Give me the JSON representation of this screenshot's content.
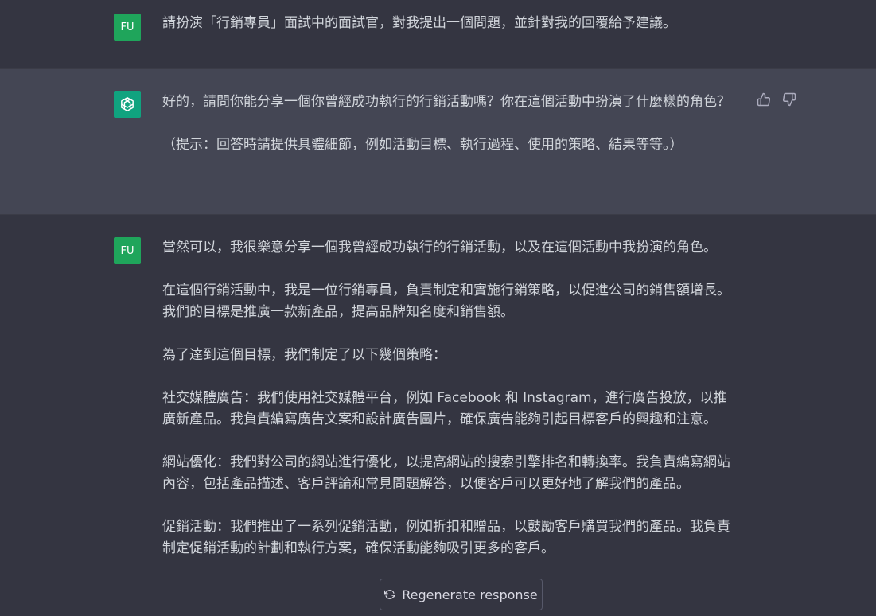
{
  "messages": [
    {
      "role": "user",
      "avatar": "FU",
      "paragraphs": [
        "請扮演「行銷專員」面試中的面試官，對我提出一個問題，並針對我的回覆給予建議。"
      ]
    },
    {
      "role": "assistant",
      "avatar_icon": "openai-logo-icon",
      "paragraphs": [
        "好的，請問你能分享一個你曾經成功執行的行銷活動嗎？你在這個活動中扮演了什麼樣的角色？",
        "（提示：回答時請提供具體細節，例如活動目標、執行過程、使用的策略、結果等等。）"
      ]
    },
    {
      "role": "user",
      "avatar": "FU",
      "paragraphs": [
        "當然可以，我很樂意分享一個我曾經成功執行的行銷活動，以及在這個活動中我扮演的角色。",
        "在這個行銷活動中，我是一位行銷專員，負責制定和實施行銷策略，以促進公司的銷售額增長。我們的目標是推廣一款新產品，提高品牌知名度和銷售額。",
        "為了達到這個目標，我們制定了以下幾個策略：",
        "社交媒體廣告：我們使用社交媒體平台，例如 Facebook 和 Instagram，進行廣告投放，以推廣新產品。我負責編寫廣告文案和設計廣告圖片，確保廣告能夠引起目標客戶的興趣和注意。",
        "網站優化：我們對公司的網站進行優化，以提高網站的搜索引擎排名和轉換率。我負責編寫網站內容，包括產品描述、客戶評論和常見問題解答，以便客戶可以更好地了解我們的產品。",
        "促銷活動：我們推出了一系列促銷活動，例如折扣和贈品，以鼓勵客戶購買我們的產品。我負責制定促銷活動的計劃和執行方案，確保活動能夠吸引更多的客戶。"
      ]
    }
  ],
  "feedback": {
    "like_icon": "thumbs-up-icon",
    "dislike_icon": "thumbs-down-icon"
  },
  "regenerate": {
    "label": "Regenerate response",
    "icon": "refresh-icon"
  },
  "colors": {
    "background": "#343541",
    "assistant_background": "#444654",
    "user_avatar": "#1fa55b",
    "assistant_avatar": "#10a37f",
    "text": "#d1d5db"
  }
}
